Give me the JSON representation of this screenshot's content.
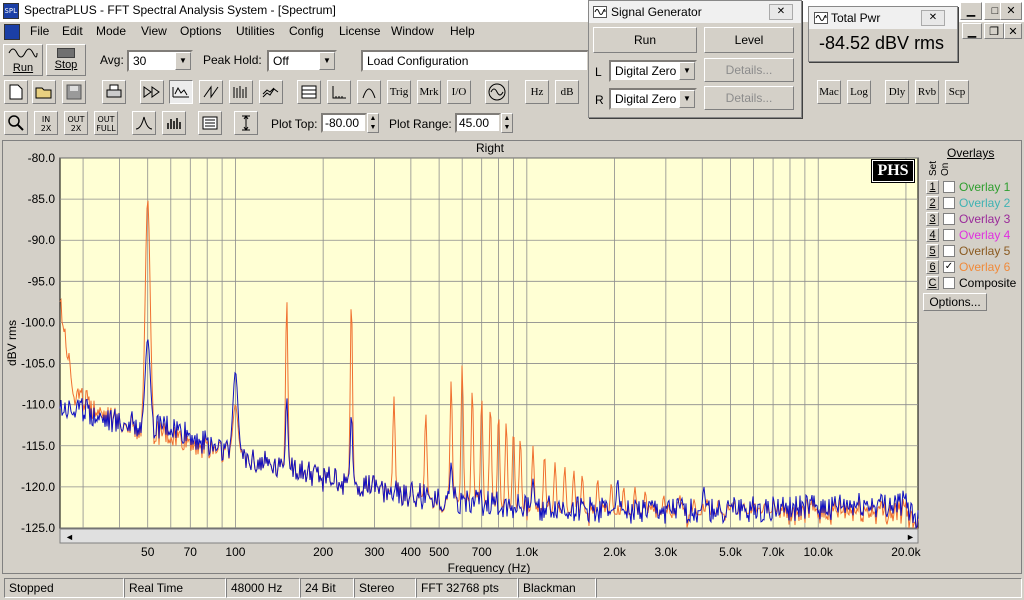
{
  "app": {
    "title": "SpectraPLUS - FFT Spectral Analysis System - [Spectrum]",
    "icon_text": "SPL"
  },
  "window_controls": {
    "minimize": "▁",
    "maximize": "□",
    "close": "✕",
    "mdi_minimize": "▁",
    "mdi_restore": "❐",
    "mdi_close": "✕"
  },
  "menu": [
    "File",
    "Edit",
    "Mode",
    "View",
    "Options",
    "Utilities",
    "Config",
    "License",
    "Window",
    "Help"
  ],
  "toolbar": {
    "run_label": "Run",
    "stop_label": "Stop",
    "avg_label": "Avg:",
    "avg_value": "30",
    "peak_hold_label": "Peak Hold:",
    "peak_hold_value": "Off",
    "config_value": "Load Configuration",
    "text_buttons_row2": [
      "Trig",
      "Mrk",
      "I/O",
      "Hz",
      "dB"
    ],
    "text_buttons_right": [
      "Mac",
      "Log",
      "Dly",
      "Rvb",
      "Scp"
    ],
    "zoom_in_label": "IN\n2X",
    "out_label": "OUT\n2X",
    "out_full_label": "OUT\nFULL",
    "plot_top_label": "Plot Top:",
    "plot_top_value": "-80.00",
    "plot_range_label": "Plot Range:",
    "plot_range_value": "45.00"
  },
  "signal_generator": {
    "title": "Signal Generator",
    "run_label": "Run",
    "level_label": "Level",
    "l_label": "L",
    "r_label": "R",
    "l_value": "Digital Zero",
    "r_value": "Digital Zero",
    "details_label": "Details..."
  },
  "total_power": {
    "title": "Total Pwr",
    "value": "-84.52 dBV rms"
  },
  "plot": {
    "channel_label": "Right",
    "logo": "PHS",
    "background": "#ffffd4",
    "overlays_label": "Overlays",
    "set_label": "Set",
    "on_label": "On",
    "options_label": "Options..."
  },
  "overlays": [
    {
      "num": "1",
      "label": "Overlay 1",
      "color": "#2e9e2e",
      "checked": false
    },
    {
      "num": "2",
      "label": "Overlay 2",
      "color": "#3fb3b3",
      "checked": false
    },
    {
      "num": "3",
      "label": "Overlay 3",
      "color": "#9a2a9a",
      "checked": false
    },
    {
      "num": "4",
      "label": "Overlay 4",
      "color": "#e030e0",
      "checked": false
    },
    {
      "num": "5",
      "label": "Overlay 5",
      "color": "#8a5a20",
      "checked": false
    },
    {
      "num": "6",
      "label": "Overlay 6",
      "color": "#f08a3a",
      "checked": true
    },
    {
      "num": "C",
      "label": "Composite",
      "color": "#000000",
      "checked": false
    }
  ],
  "statusbar": [
    "Stopped",
    "Real Time",
    "48000 Hz",
    "24 Bit",
    "Stereo",
    "FFT 32768 pts",
    "Blackman"
  ],
  "chart_data": {
    "type": "line",
    "xlabel": "Frequency (Hz)",
    "ylabel": "dBV rms",
    "xscale": "log",
    "xlim": [
      25,
      22000
    ],
    "ylim": [
      -125,
      -80
    ],
    "y_ticks": [
      "-80.0",
      "-85.0",
      "-90.0",
      "-95.0",
      "-100.0",
      "-105.0",
      "-110.0",
      "-115.0",
      "-120.0",
      "-125.0"
    ],
    "x_ticks": [
      {
        "v": 50,
        "label": "50"
      },
      {
        "v": 70,
        "label": "70"
      },
      {
        "v": 100,
        "label": "100"
      },
      {
        "v": 200,
        "label": "200"
      },
      {
        "v": 300,
        "label": "300"
      },
      {
        "v": 400,
        "label": "400"
      },
      {
        "v": 500,
        "label": "500"
      },
      {
        "v": 700,
        "label": "700"
      },
      {
        "v": 1000,
        "label": "1.0k"
      },
      {
        "v": 2000,
        "label": "2.0k"
      },
      {
        "v": 3000,
        "label": "3.0k"
      },
      {
        "v": 5000,
        "label": "5.0k"
      },
      {
        "v": 7000,
        "label": "7.0k"
      },
      {
        "v": 10000,
        "label": "10.0k"
      },
      {
        "v": 20000,
        "label": "20.0k"
      }
    ],
    "grid": true,
    "series": [
      {
        "color": "#f07030",
        "baseline": [
          [
            25,
            -97
          ],
          [
            28,
            -109
          ],
          [
            40,
            -112
          ],
          [
            60,
            -114
          ],
          [
            100,
            -116
          ],
          [
            200,
            -119
          ],
          [
            400,
            -121
          ],
          [
            1000,
            -123
          ],
          [
            3000,
            -123.5
          ],
          [
            10000,
            -123
          ],
          [
            20000,
            -123
          ],
          [
            22000,
            -125
          ]
        ],
        "peaks": [
          [
            50,
            -85
          ],
          [
            100,
            -110
          ],
          [
            150,
            -97
          ],
          [
            250,
            -97
          ],
          [
            350,
            -109
          ],
          [
            450,
            -111
          ],
          [
            550,
            -107
          ],
          [
            600,
            -105
          ],
          [
            650,
            -108
          ],
          [
            700,
            -109
          ],
          [
            750,
            -110
          ],
          [
            800,
            -111
          ],
          [
            850,
            -112
          ],
          [
            900,
            -113
          ],
          [
            950,
            -114
          ],
          [
            1050,
            -115
          ],
          [
            1150,
            -116
          ],
          [
            1250,
            -117
          ],
          [
            1350,
            -117.5
          ],
          [
            1450,
            -118
          ],
          [
            1550,
            -118.5
          ],
          [
            1750,
            -119
          ],
          [
            1950,
            -119.5
          ],
          [
            2150,
            -120
          ],
          [
            2350,
            -120
          ],
          [
            2550,
            -120.5
          ],
          [
            2950,
            -121
          ],
          [
            3350,
            -121
          ],
          [
            3750,
            -121.5
          ],
          [
            4150,
            -121.5
          ],
          [
            4550,
            -121.5
          ],
          [
            5050,
            -122
          ],
          [
            5550,
            -122
          ],
          [
            6050,
            -122
          ],
          [
            6550,
            -122
          ],
          [
            7050,
            -122
          ]
        ]
      },
      {
        "color": "#1010c0",
        "baseline": [
          [
            25,
            -110
          ],
          [
            40,
            -112
          ],
          [
            60,
            -113
          ],
          [
            100,
            -116
          ],
          [
            200,
            -119
          ],
          [
            400,
            -121
          ],
          [
            1000,
            -122.5
          ],
          [
            3000,
            -123
          ],
          [
            10000,
            -122.5
          ],
          [
            20000,
            -122
          ],
          [
            22000,
            -124
          ]
        ],
        "peaks": [
          [
            50,
            -102
          ],
          [
            100,
            -106
          ],
          [
            150,
            -109
          ],
          [
            250,
            -111
          ],
          [
            550,
            -117
          ],
          [
            1050,
            -119
          ],
          [
            2050,
            -119
          ],
          [
            4050,
            -120
          ]
        ]
      }
    ]
  }
}
